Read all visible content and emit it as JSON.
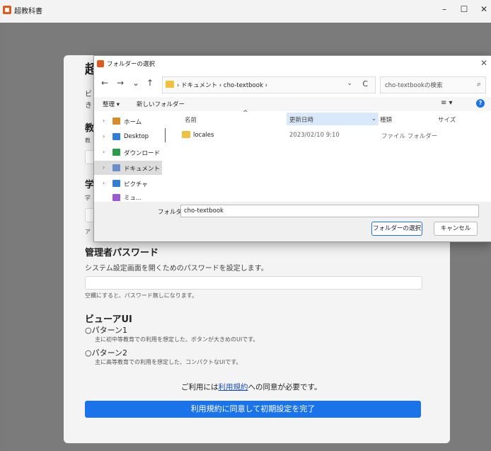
{
  "app": {
    "title": "超教科書",
    "controls": {
      "minimize": "–",
      "maximize": "☐",
      "close": "✕"
    }
  },
  "setup": {
    "partial_heading_glyph": "超",
    "partial_desc_glyph_1": "ビ",
    "partial_desc_glyph_2": "き",
    "section1_glyph": "教",
    "section1_sub_glyph": "教",
    "section2_glyph": "学",
    "section2_sub_glyph": "学",
    "hint_glyph": "ア",
    "admin": {
      "heading": "管理者パスワード",
      "desc": "システム設定画面を開くためのパスワードを設定します。",
      "value": "",
      "hint": "空欄にすると、パスワード無しになります。"
    },
    "viewer": {
      "heading": "ビューアUI",
      "pattern1_label": "○パターン1",
      "pattern1_desc": "主に初中等教育での利用を想定した、ボタンが大きめのUIです。",
      "pattern2_label": "○パターン2",
      "pattern2_desc": "主に高等教育での利用を想定した、コンパクトなUIです。"
    },
    "terms_prefix": "ご利用には",
    "terms_link": "利用規約",
    "terms_suffix": "への同意が必要です。",
    "submit_label": "利用規約に同意して初期設定を完了"
  },
  "dialog": {
    "title": "フォルダーの選択",
    "nav": {
      "back": "←",
      "forward": "→",
      "recent": "⌄",
      "up": "↑"
    },
    "address": "› ドキュメント › cho-textbook ›",
    "address_dropdown": "⌄",
    "refresh": "C",
    "search_placeholder": "cho-textbookの検索",
    "search_icon": "⌕",
    "toolbar": {
      "organize": "整理 ▾",
      "new_folder": "新しいフォルダー",
      "view": "≡ ▾",
      "help": "?"
    },
    "nav_items": [
      {
        "label": "ホーム",
        "icon": "home-icon",
        "color": "#d98a2b"
      },
      {
        "label": "Desktop",
        "icon": "desktop-icon",
        "color": "#2f7fd9"
      },
      {
        "label": "ダウンロード",
        "icon": "download-icon",
        "color": "#2a9d4b"
      },
      {
        "label": "ドキュメント",
        "icon": "documents-icon",
        "color": "#6a8fc7"
      },
      {
        "label": "ピクチャ",
        "icon": "pictures-icon",
        "color": "#2f7fd9"
      },
      {
        "label": "ミュ...",
        "icon": "music-icon",
        "color": "#9c5ad1"
      }
    ],
    "columns": {
      "name": "名前",
      "date": "更新日時",
      "type": "種類",
      "size": "サイズ"
    },
    "files": [
      {
        "name": "locales",
        "date": "2023/02/10 9:10",
        "type": "ファイル フォルダー",
        "size": ""
      }
    ],
    "folder_label": "フォルダー:",
    "folder_value": "cho-textbook",
    "select_button": "フォルダーの選択",
    "cancel_button": "キャンセル"
  }
}
